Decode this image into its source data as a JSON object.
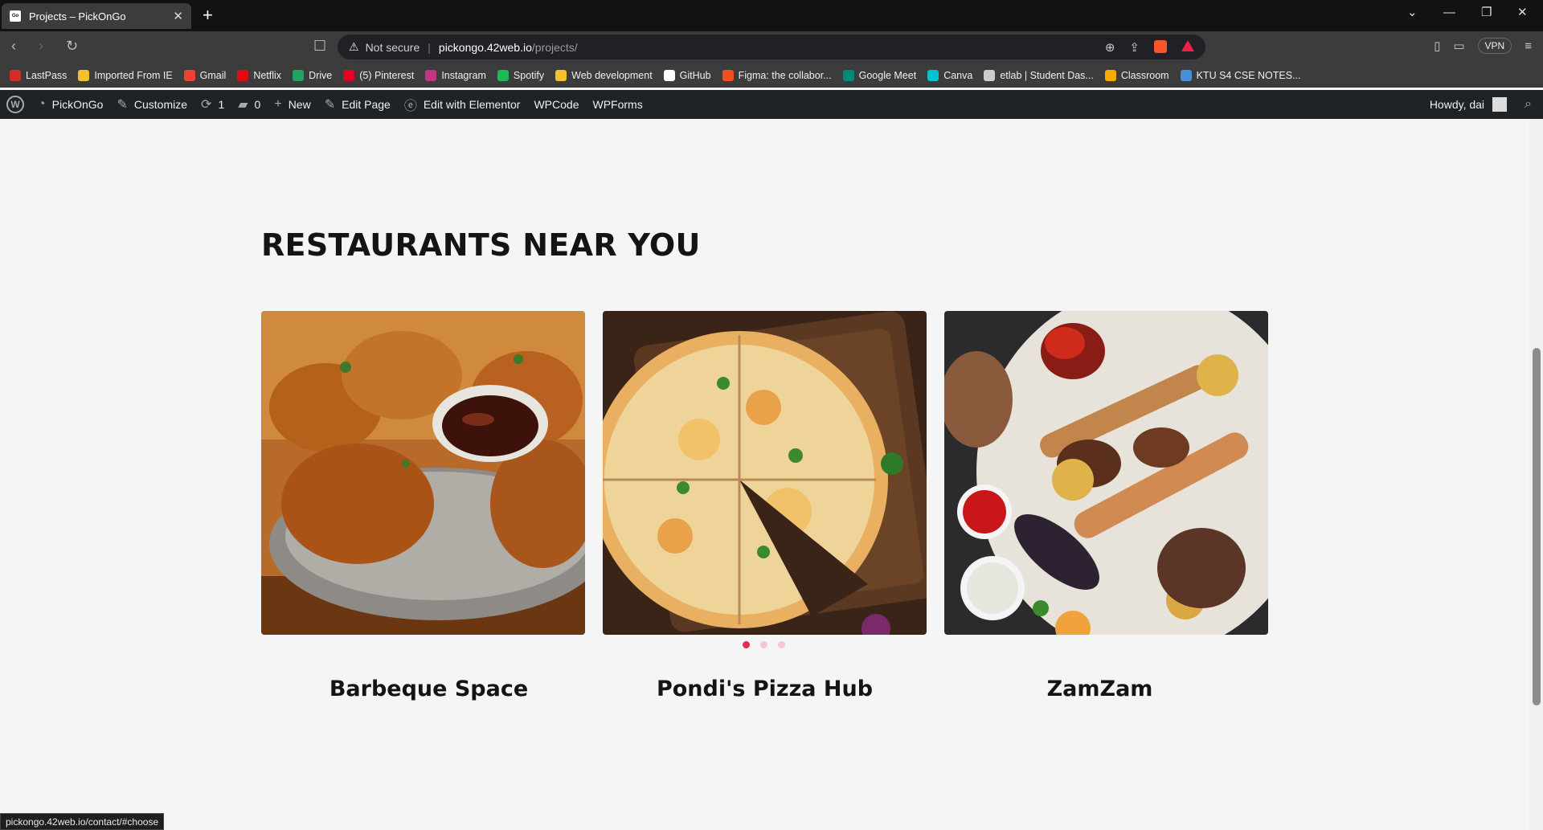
{
  "browser": {
    "tab_title": "Projects – PickOnGo",
    "address": {
      "security": "Not secure",
      "host": "pickongo.42web.io",
      "path": "/projects/"
    },
    "vpn_label": "VPN",
    "bookmarks": [
      {
        "label": "LastPass",
        "color": "#d32d27"
      },
      {
        "label": "Imported From IE",
        "color": "#f2c12e"
      },
      {
        "label": "Gmail",
        "color": "#ea4335"
      },
      {
        "label": "Netflix",
        "color": "#e50914"
      },
      {
        "label": "Drive",
        "color": "#1fa463"
      },
      {
        "label": "(5) Pinterest",
        "color": "#e60023"
      },
      {
        "label": "Instagram",
        "color": "#c13584"
      },
      {
        "label": "Spotify",
        "color": "#1db954"
      },
      {
        "label": "Web development",
        "color": "#f2c12e"
      },
      {
        "label": "GitHub",
        "color": "#ffffff"
      },
      {
        "label": "Figma: the collabor...",
        "color": "#f24e1e"
      },
      {
        "label": "Google Meet",
        "color": "#00897b"
      },
      {
        "label": "Canva",
        "color": "#00c4cc"
      },
      {
        "label": "etlab | Student Das...",
        "color": "#cccccc"
      },
      {
        "label": "Classroom",
        "color": "#f9ab00"
      },
      {
        "label": "KTU S4 CSE NOTES...",
        "color": "#4a90d9"
      }
    ]
  },
  "adminbar": {
    "site": "PickOnGo",
    "customize": "Customize",
    "updates": "1",
    "comments": "0",
    "new": "New",
    "edit_page": "Edit Page",
    "elementor": "Edit with Elementor",
    "wpcode": "WPCode",
    "wpforms": "WPForms",
    "howdy": "Howdy, dai"
  },
  "main": {
    "heading": "RESTAURANTS NEAR YOU",
    "restaurants": [
      {
        "name": "Barbeque Space",
        "image": "fried-chicken-photo"
      },
      {
        "name": "Pondi's Pizza Hub",
        "image": "pizza-photo"
      },
      {
        "name": "ZamZam",
        "image": "grill-platter-photo"
      }
    ],
    "carousel": {
      "pages": 3,
      "active": 1,
      "accent": "#e8294f"
    }
  },
  "status_url": "pickongo.42web.io/contact/#choose"
}
